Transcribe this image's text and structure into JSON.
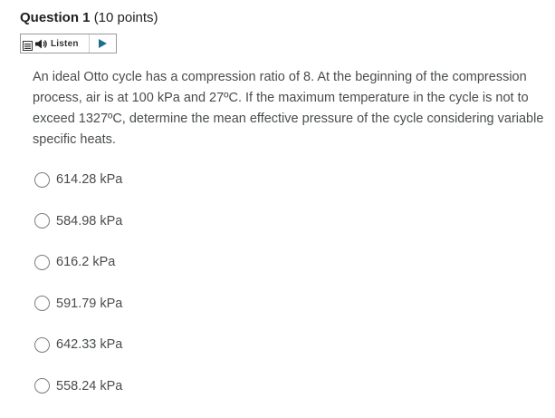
{
  "question": {
    "title": "Question 1",
    "points": "(10 points)",
    "text": "An ideal Otto cycle has a compression ratio of 8. At the beginning of the compression process, air is at 100 kPa and 27ºC. If the maximum temperature in the cycle is not to exceed 1327ºC, determine the mean effective pressure of the cycle considering variable specific heats."
  },
  "listen": {
    "label": "Listen",
    "icons": [
      "menu-icon",
      "speaker-icon",
      "play-icon"
    ]
  },
  "options": [
    {
      "label": "614.28 kPa"
    },
    {
      "label": "584.98 kPa"
    },
    {
      "label": "616.2 kPa"
    },
    {
      "label": "591.79 kPa"
    },
    {
      "label": "642.33 kPa"
    },
    {
      "label": "558.24 kPa"
    }
  ]
}
